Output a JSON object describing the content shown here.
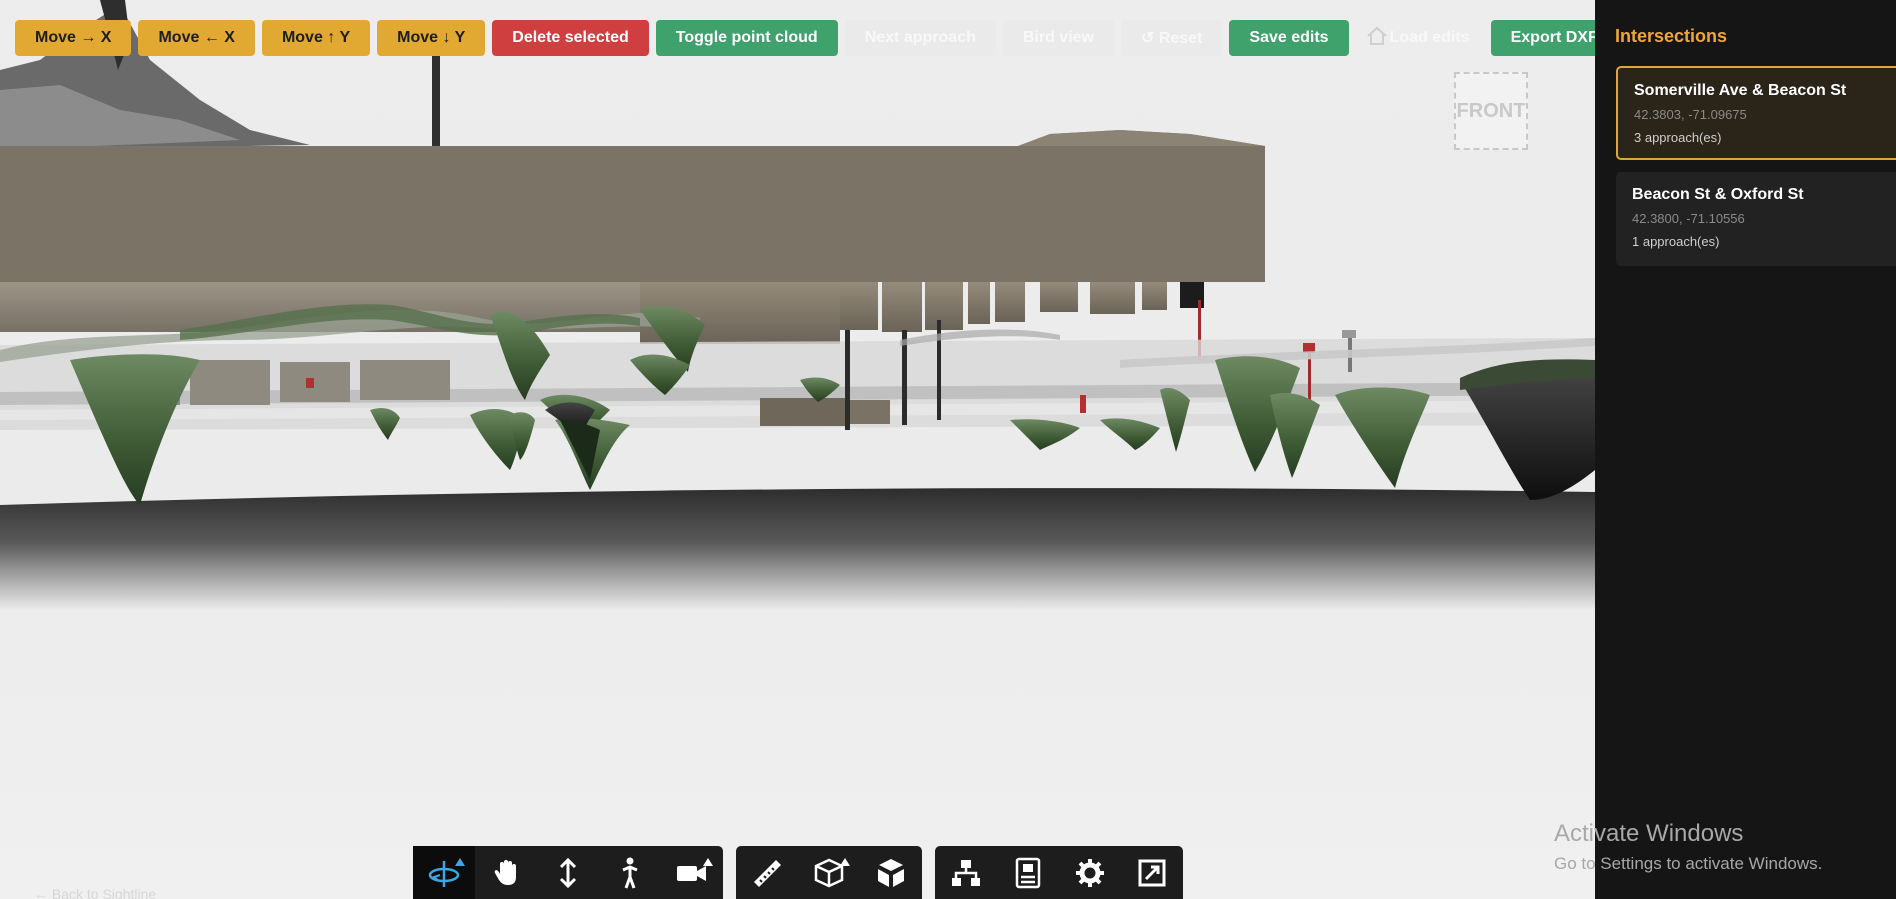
{
  "toolbar": {
    "buttons": [
      {
        "label": "Move → X"
      },
      {
        "label": "Move ← X"
      },
      {
        "label": "Move ↑ Y"
      },
      {
        "label": "Move ↓ Y"
      },
      {
        "label": "Delete selected"
      },
      {
        "label": "Toggle point cloud"
      },
      {
        "label": "Next approach"
      },
      {
        "label": "Bird view"
      },
      {
        "label": "↺ Reset"
      },
      {
        "label": "Save edits"
      },
      {
        "label": "Load edits"
      },
      {
        "label": "Export DXF"
      }
    ]
  },
  "viewcube": {
    "face_label": "FRONT"
  },
  "panel": {
    "title": "Intersections",
    "intersections": [
      {
        "name": "Somerville Ave & Beacon St",
        "coords": "42.3803, -71.09675",
        "approaches": "3 approach(es)",
        "selected": true
      },
      {
        "name": "Beacon St & Oxford St",
        "coords": "42.3800, -71.10556",
        "approaches": "1 approach(es)",
        "selected": false
      }
    ]
  },
  "bottom_toolbar": {
    "icons": [
      "orbit-icon",
      "pan-hand-icon",
      "vertical-move-icon",
      "walk-person-icon",
      "camera-icon",
      "measure-ruler-icon",
      "section-box-icon",
      "explode-cube-icon",
      "model-tree-icon",
      "properties-icon",
      "settings-gear-icon",
      "fullscreen-icon"
    ]
  },
  "back_link": "← Back to Sightline",
  "watermark": {
    "line1": "Activate Windows",
    "line2": "Go to Settings to activate Windows."
  },
  "colors": {
    "accent": "#e2a932",
    "danger": "#d03f3f",
    "success": "#3fa16c",
    "panel_bg": "#151515",
    "panel_title": "#f0a53a"
  }
}
